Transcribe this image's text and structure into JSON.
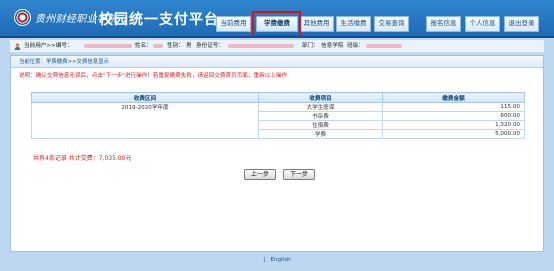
{
  "header": {
    "school_name": "贵州财经职业学院",
    "platform_title": "校园统一支付平台",
    "nav": [
      {
        "label": "当前费用"
      },
      {
        "label": "学费缴费"
      },
      {
        "label": "其他费用"
      },
      {
        "label": "生活缴费"
      },
      {
        "label": "交易查询"
      },
      {
        "label": "报名信息"
      },
      {
        "label": "个人信息"
      },
      {
        "label": "退出登录"
      }
    ],
    "active_nav": "学费缴费"
  },
  "userbar": {
    "current_user_label": "当前用户>>编号：",
    "name_label": "姓名：",
    "gender_label": "性别：",
    "gender_value": "男",
    "id_label": "身份证号：",
    "dept_label": "部门：",
    "dept_value": "信息学院",
    "class_label": "班级："
  },
  "breadcrumb": "当前位置：学费缴费>>交费信息显示",
  "notice": "说明：确认交费信息无误后，点击\"下一步\"进行操作！若重复缴费失败，请返回交费首页页面，重新以上操作",
  "table": {
    "headers": [
      "收费区间",
      "收费项目",
      "缴费金额"
    ],
    "interval": "2019-2020学年度",
    "rows": [
      {
        "item": "大学生医保",
        "amount": "115.00"
      },
      {
        "item": "书杂费",
        "amount": "600.00"
      },
      {
        "item": "住宿费",
        "amount": "1,320.00"
      },
      {
        "item": "学费",
        "amount": "5,000.00"
      }
    ]
  },
  "summary": "共有4条记录  共计交费：7,035.00元",
  "buttons": {
    "prev": "上一步",
    "next": "下一步"
  },
  "footer": {
    "separator": "|",
    "link": "English"
  },
  "colors": {
    "header_blue": "#1d69b4",
    "notice_red": "#d61f1f",
    "highlight_red": "#e01010"
  }
}
